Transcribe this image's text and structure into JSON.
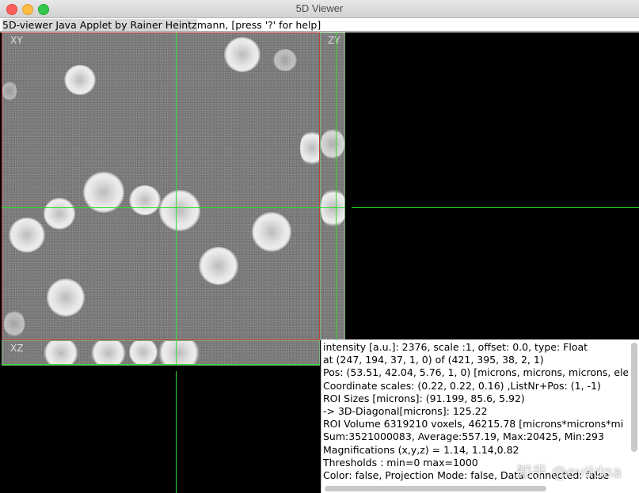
{
  "window": {
    "title": "5D Viewer"
  },
  "applet": {
    "label_selected": "5D-viewer Java Applet by Rainer Heintz",
    "label_rest": "mann, [press '?' for help]"
  },
  "views": {
    "xy_label": "XY",
    "zy_label": "ZY",
    "xz_label": "XZ"
  },
  "info": {
    "lines": [
      "intensity [a.u.]: 2376, scale :1, offset: 0.0, type: Float",
      "at (247, 194, 37, 1, 0) of (421, 395, 38, 2, 1)",
      "Pos: (53.51, 42.04, 5.76, 1, 0) [microns, microns, microns, ele",
      "Coordinate scales: (0.22, 0.22, 0.16)  ,ListNr+Pos: (1, -1)",
      "ROI Sizes [microns]: (91.199, 85.6, 5.92)",
      " -> 3D-Diagonal[microns]: 125.22",
      "ROI Volume 6319210 voxels, 46215.78 [microns*microns*mi",
      "Sum:3521000083, Average:557.19, Max:20425, Min:293",
      "Magnifications (x,y,z) = 1.14, 1.14,0.82",
      "Thresholds : min=0 max=1000",
      "Color: false, Projection Mode: false, Data connected: false"
    ]
  },
  "watermark": "知乎 @evildna",
  "colors": {
    "crosshair": "#2ee02e",
    "active_border": "#c04040",
    "background": "#000000"
  }
}
